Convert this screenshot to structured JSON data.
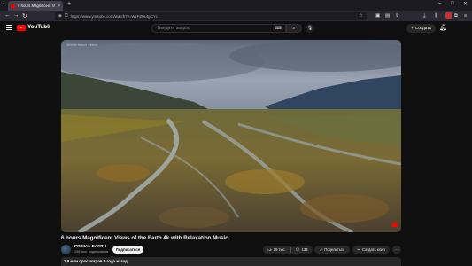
{
  "browser": {
    "tab_title": "6 hours Magnificent Views o",
    "tab_close": "×",
    "new_tab": "+",
    "url": "https://www.youtube.com/watch?v=WzFZ0x4gCYc"
  },
  "youtube": {
    "logo_text": "YouTube",
    "country_code": "RU",
    "search_placeholder": "Введите запрос",
    "create_label": "Создать",
    "brand_color": "#ff0000"
  },
  "video": {
    "watermark": "Wildlife Nature Videos",
    "title": "6 hours Magnificent Views of the Earth 4k with Relaxation Music",
    "channel": "PRIMAL EARTH",
    "subscribers": "198 тыс. подписчиков",
    "subscribe_label": "Подписаться",
    "likes": "19 тыс.",
    "comments": "132",
    "share_label": "Поделиться",
    "clip_label": "Создать клип",
    "more_label": "···",
    "views_line": "2,9 млн просмотров  3 года назад"
  }
}
